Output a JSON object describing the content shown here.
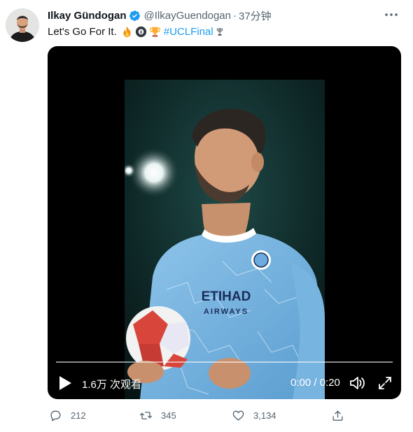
{
  "tweet": {
    "author_name": "Ilkay Gündogan",
    "handle": "@IlkayGuendogan",
    "separator": "·",
    "time": "37分钟",
    "text": "Let's Go For It.",
    "hashtag": "#UCLFinal",
    "emojis": [
      "fire-emoji",
      "8-ball-emoji",
      "trophy-emoji",
      "ucl-trophy-emoji"
    ],
    "verified": true
  },
  "video": {
    "views_label": "1.6万 次观看",
    "time_label": "0:00 / 0:20",
    "progress": 0,
    "jersey_sponsor": "ETIHAD",
    "jersey_sponsor_sub": "AIRWAYS"
  },
  "actions": {
    "replies": "212",
    "retweets": "345",
    "likes": "3,134"
  },
  "colors": {
    "link": "#1d9bf0",
    "text": "#0f1419",
    "muted": "#536471",
    "jersey": "#6cabdd"
  }
}
